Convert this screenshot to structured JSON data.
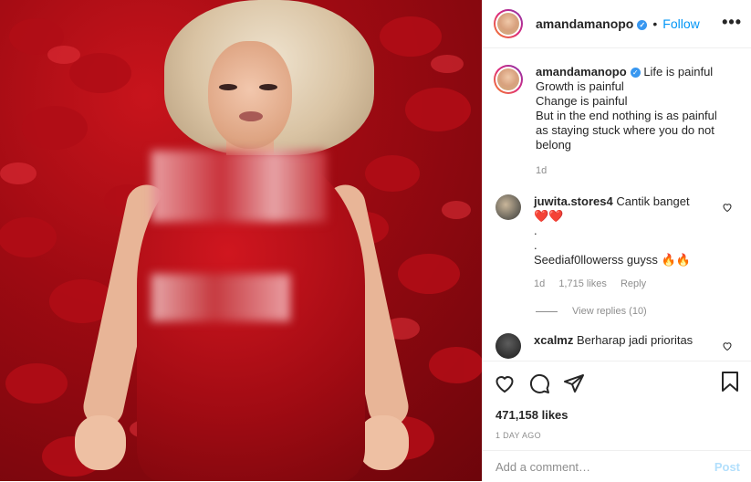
{
  "header": {
    "username": "amandamanopo",
    "verified_mark": "✓",
    "separator": "•",
    "follow_label": "Follow",
    "more_label": "•••"
  },
  "caption": {
    "username": "amandamanopo",
    "verified_mark": "✓",
    "lines": [
      "Life is painful",
      "Growth is painful",
      "Change is painful",
      "But in the end nothing is as painful",
      "as staying stuck where you do not",
      "belong"
    ],
    "time": "1d"
  },
  "comments": [
    {
      "username": "juwita.stores4",
      "lines": [
        "Cantik banget",
        "❤️❤️",
        ".",
        ".",
        "Seediaf0llowerss guyss 🔥🔥"
      ],
      "time": "1d",
      "likes": "1,715 likes",
      "reply_label": "Reply",
      "view_replies": "View replies (10)"
    },
    {
      "username": "xcalmz",
      "lines": [
        "Berharap jadi prioritas"
      ]
    }
  ],
  "actions": {
    "likes": "471,158 likes",
    "date": "1 DAY AGO"
  },
  "add_comment": {
    "placeholder": "Add a comment…",
    "post_label": "Post"
  },
  "icons": [
    "more-icon",
    "heart-icon",
    "comment-icon",
    "share-icon",
    "bookmark-icon",
    "verified-icon"
  ],
  "colors": {
    "accent": "#0095f6",
    "verified": "#3897f0",
    "muted": "#8e8e8e"
  }
}
